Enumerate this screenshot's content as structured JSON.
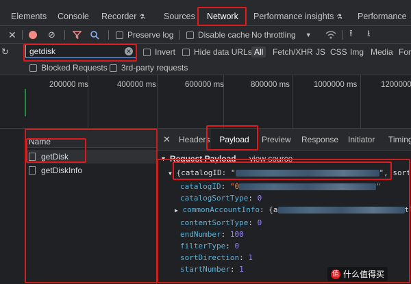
{
  "panels": {
    "tabs": [
      "Elements",
      "Console",
      "Recorder",
      "Sources",
      "Network",
      "Performance insights",
      "Performance"
    ],
    "active": "Network"
  },
  "toolbar": {
    "preserve_log": "Preserve log",
    "disable_cache": "Disable cache",
    "throttling": "No throttling"
  },
  "filter": {
    "value": "getdisk",
    "invert": "Invert",
    "hide_data_urls": "Hide data URLs",
    "types": [
      "All",
      "Fetch/XHR",
      "JS",
      "CSS",
      "Img",
      "Media",
      "Fon"
    ],
    "blocked_requests": "Blocked Requests",
    "third_party": "3rd-party requests"
  },
  "timeline": {
    "ticks": [
      "200000 ms",
      "400000 ms",
      "600000 ms",
      "800000 ms",
      "1000000 ms",
      "1200000"
    ]
  },
  "requests": {
    "header": "Name",
    "items": [
      "getDisk",
      "getDiskInfo"
    ]
  },
  "details": {
    "tabs": [
      "Headers",
      "Payload",
      "Preview",
      "Response",
      "Initiator",
      "Timing"
    ],
    "active": "Payload",
    "section_title": "Request Payload",
    "view_source": "view source",
    "payload_open": "{catalogID: \"",
    "payload_tail": "\", sortDi",
    "fields": [
      {
        "key": "catalogID",
        "value": "\"0",
        "type": "str"
      },
      {
        "key": "catalogSortType",
        "value": "0",
        "type": "num"
      },
      {
        "key": "commonAccountInfo",
        "value": "{a",
        "type": "obj",
        "tail": "tTy"
      },
      {
        "key": "contentSortType",
        "value": "0",
        "type": "num"
      },
      {
        "key": "endNumber",
        "value": "100",
        "type": "num"
      },
      {
        "key": "filterType",
        "value": "0",
        "type": "num"
      },
      {
        "key": "sortDirection",
        "value": "1",
        "type": "num"
      },
      {
        "key": "startNumber",
        "value": "1",
        "type": "num"
      }
    ]
  },
  "watermark": "什么值得买",
  "colors": {
    "highlight": "#e0191d",
    "accent": "#8ab4f8",
    "record": "#f28b82"
  }
}
